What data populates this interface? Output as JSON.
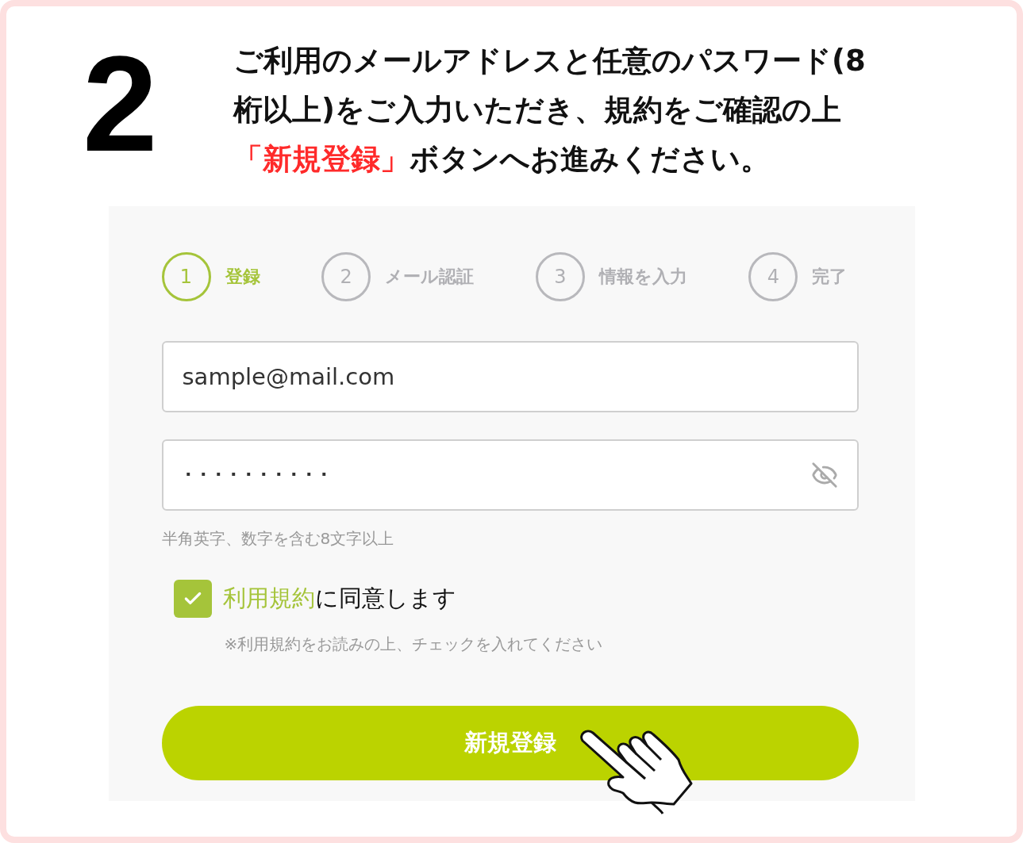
{
  "step_number": "2",
  "instruction_lines": [
    [
      {
        "text": "ご利用のメールアドレスと任意のパスワード(8",
        "highlight": false
      }
    ],
    [
      {
        "text": "桁以上)をご入力いただき、規約をご確認の上",
        "highlight": false
      }
    ],
    [
      {
        "text": "「新規登録」",
        "highlight": true
      },
      {
        "text": "ボタンへお進みください。",
        "highlight": false
      }
    ]
  ],
  "steps": [
    {
      "number": "1",
      "label": "登録",
      "selected": true
    },
    {
      "number": "2",
      "label": "メール認証",
      "selected": false
    },
    {
      "number": "3",
      "label": "情報を入力",
      "selected": false
    },
    {
      "number": "4",
      "label": "完了",
      "selected": false
    }
  ],
  "email": {
    "value": "sample@mail.com"
  },
  "password": {
    "value": "･･････････"
  },
  "password_hint": "半角英字、数字を含む8文字以上",
  "terms": {
    "checked": true,
    "link": "利用規約",
    "label": "に同意します",
    "note": "※利用規約をお読みの上、チェックを入れてください"
  },
  "submit": "新規登録"
}
